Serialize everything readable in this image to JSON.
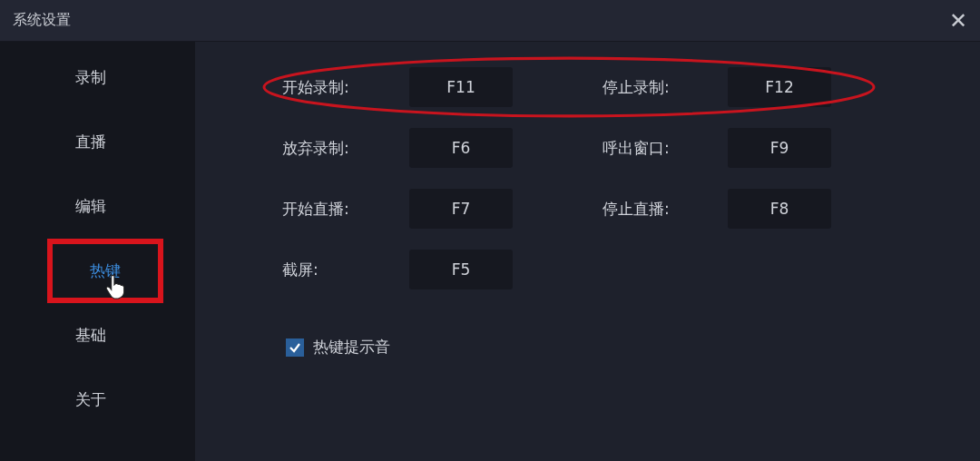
{
  "window": {
    "title": "系统设置",
    "close": "✕"
  },
  "sidebar": {
    "items": [
      {
        "label": "录制",
        "selected": false,
        "highlighted": false,
        "pointer": false
      },
      {
        "label": "直播",
        "selected": false,
        "highlighted": false,
        "pointer": false
      },
      {
        "label": "编辑",
        "selected": false,
        "highlighted": false,
        "pointer": false
      },
      {
        "label": "热键",
        "selected": true,
        "highlighted": true,
        "pointer": true
      },
      {
        "label": "基础",
        "selected": false,
        "highlighted": false,
        "pointer": false
      },
      {
        "label": "关于",
        "selected": false,
        "highlighted": false,
        "pointer": false
      }
    ]
  },
  "hotkey_rows": [
    {
      "highlighted": true,
      "items": [
        {
          "label": "开始录制:",
          "key": "F11"
        },
        {
          "label": "停止录制:",
          "key": "F12"
        }
      ]
    },
    {
      "highlighted": false,
      "items": [
        {
          "label": "放弃录制:",
          "key": "F6"
        },
        {
          "label": "呼出窗口:",
          "key": "F9"
        }
      ]
    },
    {
      "highlighted": false,
      "items": [
        {
          "label": "开始直播:",
          "key": "F7"
        },
        {
          "label": "停止直播:",
          "key": "F8"
        }
      ]
    },
    {
      "highlighted": false,
      "items": [
        {
          "label": "截屏:",
          "key": "F5"
        }
      ]
    }
  ],
  "sound_option": {
    "label": "热键提示音",
    "checked": true
  }
}
